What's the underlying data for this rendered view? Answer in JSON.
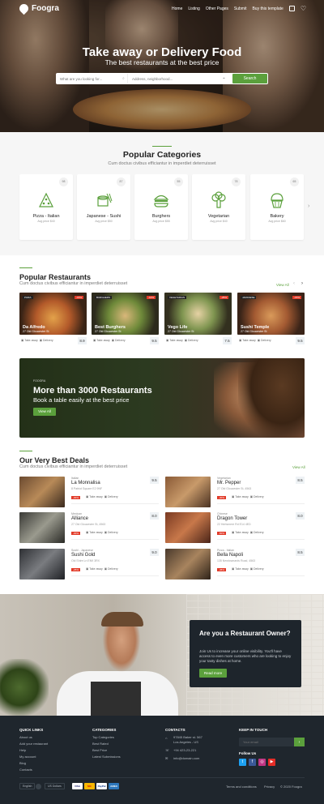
{
  "brand": {
    "name": "Foogra"
  },
  "nav": {
    "items": [
      "Home",
      "Listing",
      "Other Pages",
      "Submit",
      "Buy this template"
    ]
  },
  "hero": {
    "title": "Take away or Delivery Food",
    "subtitle": "The best restaurants at the best price",
    "search_placeholder": "What are you looking for...",
    "location_placeholder": "Address, neighborhood...",
    "search_button": "Search"
  },
  "categories": {
    "title": "Popular Categories",
    "subtitle": "Cum doctus civibus efficiantur in imperdiet deterruisset",
    "items": [
      {
        "name": "Pizza - Italian",
        "count": "98",
        "avg": "Avg price $40",
        "icon": "pizza-icon"
      },
      {
        "name": "Japanese - Sushi",
        "count": "87",
        "avg": "Avg price $50",
        "icon": "sushi-icon"
      },
      {
        "name": "Burghers",
        "count": "55",
        "avg": "Avg price $55",
        "icon": "burger-icon"
      },
      {
        "name": "Vegetarian",
        "count": "78",
        "avg": "Avg price $40",
        "icon": "broccoli-icon"
      },
      {
        "name": "Bakery",
        "count": "65",
        "avg": "Avg price $60",
        "icon": "cupcake-icon"
      }
    ]
  },
  "popular": {
    "title": "Popular Restaurants",
    "subtitle": "Cum doctus civibus efficiantur in imperdiet deterruisset",
    "view_all": "View All",
    "items": [
      {
        "tag": "PIZZA",
        "discount": "-15%",
        "name": "Da Alfredo",
        "address": "27 Old Gloucester St",
        "score": "8.9"
      },
      {
        "tag": "BURGHERS",
        "discount": "-10%",
        "name": "Best Burghers",
        "address": "27 Old Gloucester St",
        "score": "9.5"
      },
      {
        "tag": "VEGETARIAN",
        "discount": "-25%",
        "name": "Vego Life",
        "address": "27 Old Gloucester St",
        "score": "7.5"
      },
      {
        "tag": "JAPANESE",
        "discount": "-15%",
        "name": "Sushi Temple",
        "address": "27 Old Gloucester St",
        "score": "9.5"
      }
    ],
    "take_away": "Take away",
    "delivery": "Delivery"
  },
  "banner": {
    "brand": "FOOGRA",
    "title": "More than 3000 Restaurants",
    "subtitle": "Book a table easily at the best price",
    "button": "View All"
  },
  "deals": {
    "title": "Our Very Best Deals",
    "subtitle": "Cum doctus civibus efficiantur in imperdiet deterruisset",
    "view_all": "View All",
    "items": [
      {
        "category": "Italian",
        "name": "La Monnalisa",
        "address": "8 Patriot Square E2 9NF",
        "score": "9.5",
        "discount": "-30%"
      },
      {
        "category": "Vegetarian",
        "name": "Mr. Pepper",
        "address": "27 Old Gloucester St, 4563",
        "score": "8.5",
        "discount": "-40%"
      },
      {
        "category": "Mexican",
        "name": "Alliance",
        "address": "27 Old Gloucester St, 4563",
        "score": "8.0",
        "discount": "-30%"
      },
      {
        "category": "Chinese",
        "name": "Dragon Tower",
        "address": "22 Hertsmere Rd E14 4ED",
        "score": "8.0",
        "discount": "-50%"
      },
      {
        "category": "Sushi - Japanese",
        "name": "Sushi Gold",
        "address": "Old Shire Ln EN9 3RX",
        "score": "9.0",
        "discount": "-25%"
      },
      {
        "category": "Pizza - Italian",
        "name": "Bella Napoli",
        "address": "135 Newtownards Road, 4563",
        "score": "8.5",
        "discount": "-45%"
      }
    ]
  },
  "owner": {
    "title": "Are you a Restaurant Owner?",
    "text": "Join Us to increase your online visibility. You'll have access to even more customers who are looking to enjoy your tasty dishes at home.",
    "button": "Read more"
  },
  "footer": {
    "quick_links": {
      "title": "QUICK LINKS",
      "items": [
        "About us",
        "Add your restaurant",
        "Help",
        "My account",
        "Blog",
        "Contacts"
      ]
    },
    "categories": {
      "title": "CATEGORIES",
      "items": [
        "Top Categories",
        "Best Rated",
        "Best Price",
        "Latest Submissions"
      ]
    },
    "contacts": {
      "title": "CONTACTS",
      "address1": "97845 Baker st. 567",
      "address2": "Los Angeles - US",
      "phone": "+94 423-23-221",
      "email": "info@domain.com"
    },
    "newsletter": {
      "title": "KEEP IN TOUCH",
      "placeholder": "Your email",
      "follow": "Follow Us"
    },
    "language": "English",
    "currency": "US Dollars",
    "cards": [
      "VISA",
      "MC",
      "PayPal",
      "AMEX"
    ],
    "bottom": [
      "Terms and conditions",
      "Privacy",
      "© 2020 Foogra"
    ]
  },
  "colors": {
    "accent": "#5ba03c",
    "discount": "#e23b29",
    "footer": "#1f262d"
  }
}
